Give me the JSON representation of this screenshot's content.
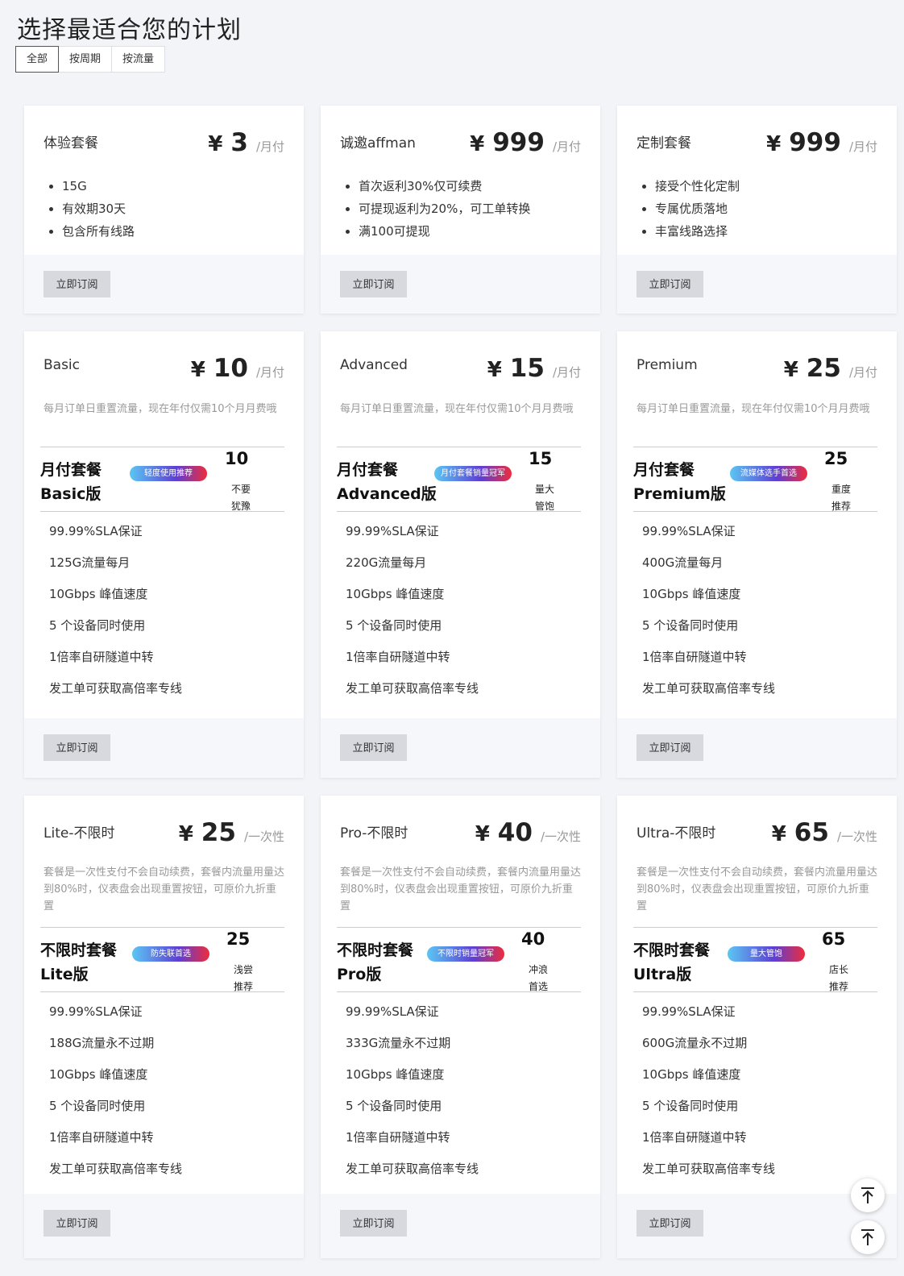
{
  "page_title": "选择最适合您的计划",
  "tabs": [
    "全部",
    "按周期",
    "按流量"
  ],
  "currency": "¥",
  "subscribe_label": "立即订阅",
  "row1": [
    {
      "name": "体验套餐",
      "price": "3",
      "unit": "/月付",
      "bullets": [
        "15G",
        "有效期30天",
        "包含所有线路"
      ]
    },
    {
      "name": "诚邀affman",
      "price": "999",
      "unit": "/月付",
      "bullets": [
        "首次返利30%仅可续费",
        "可提现返利为20%，可工单转换",
        "满100可提现"
      ]
    },
    {
      "name": "定制套餐",
      "price": "999",
      "unit": "/月付",
      "bullets": [
        "接受个性化定制",
        "专属优质落地",
        "丰富线路选择"
      ]
    }
  ],
  "row2": [
    {
      "name": "Basic",
      "price": "10",
      "unit": "/月付",
      "desc": "每月订单日重置流量，现在年付仅需10个月月费哦",
      "banner": {
        "line1": "月付套餐",
        "line2": "Basic版",
        "badge": "轻度使用推荐",
        "num": "10",
        "note": "不要犹豫"
      },
      "features": [
        "99.99%SLA保证",
        "125G流量每月",
        "10Gbps 峰值速度",
        "5 个设备同时使用",
        "1倍率自研隧道中转",
        "发工单可获取高倍率专线"
      ]
    },
    {
      "name": "Advanced",
      "price": "15",
      "unit": "/月付",
      "desc": "每月订单日重置流量，现在年付仅需10个月月费哦",
      "banner": {
        "line1": "月付套餐",
        "line2": "Advanced版",
        "badge": "月付套餐销量冠军",
        "num": "15",
        "note": "量大管饱"
      },
      "features": [
        "99.99%SLA保证",
        "220G流量每月",
        "10Gbps 峰值速度",
        "5 个设备同时使用",
        "1倍率自研隧道中转",
        "发工单可获取高倍率专线"
      ]
    },
    {
      "name": "Premium",
      "price": "25",
      "unit": "/月付",
      "desc": "每月订单日重置流量，现在年付仅需10个月月费哦",
      "banner": {
        "line1": "月付套餐",
        "line2": "Premium版",
        "badge": "流媒体选手首选",
        "num": "25",
        "note": "重度推荐"
      },
      "features": [
        "99.99%SLA保证",
        "400G流量每月",
        "10Gbps 峰值速度",
        "5 个设备同时使用",
        "1倍率自研隧道中转",
        "发工单可获取高倍率专线"
      ]
    }
  ],
  "row3": [
    {
      "name": "Lite-不限时",
      "price": "25",
      "unit": "/一次性",
      "desc": "套餐是一次性支付不会自动续费，套餐内流量用量达到80%时，仪表盘会出现重置按钮，可原价九折重置",
      "banner": {
        "line1": "不限时套餐",
        "line2": "Lite版",
        "badge": "防失联首选",
        "num": "25",
        "note": "浅尝推荐"
      },
      "features": [
        "99.99%SLA保证",
        "188G流量永不过期",
        "10Gbps 峰值速度",
        "5 个设备同时使用",
        "1倍率自研隧道中转",
        "发工单可获取高倍率专线"
      ]
    },
    {
      "name": "Pro-不限时",
      "price": "40",
      "unit": "/一次性",
      "desc": "套餐是一次性支付不会自动续费，套餐内流量用量达到80%时，仪表盘会出现重置按钮，可原价九折重置",
      "banner": {
        "line1": "不限时套餐",
        "line2": "Pro版",
        "badge": "不限时销量冠军",
        "num": "40",
        "note": "冲浪首选"
      },
      "features": [
        "99.99%SLA保证",
        "333G流量永不过期",
        "10Gbps 峰值速度",
        "5 个设备同时使用",
        "1倍率自研隧道中转",
        "发工单可获取高倍率专线"
      ]
    },
    {
      "name": "Ultra-不限时",
      "price": "65",
      "unit": "/一次性",
      "desc": "套餐是一次性支付不会自动续费，套餐内流量用量达到80%时，仪表盘会出现重置按钮，可原价九折重置",
      "banner": {
        "line1": "不限时套餐",
        "line2": "Ultra版",
        "badge": "量大管饱",
        "num": "65",
        "note": "店长推荐"
      },
      "features": [
        "99.99%SLA保证",
        "600G流量永不过期",
        "10Gbps 峰值速度",
        "5 个设备同时使用",
        "1倍率自研隧道中转",
        "发工单可获取高倍率专线"
      ]
    }
  ]
}
